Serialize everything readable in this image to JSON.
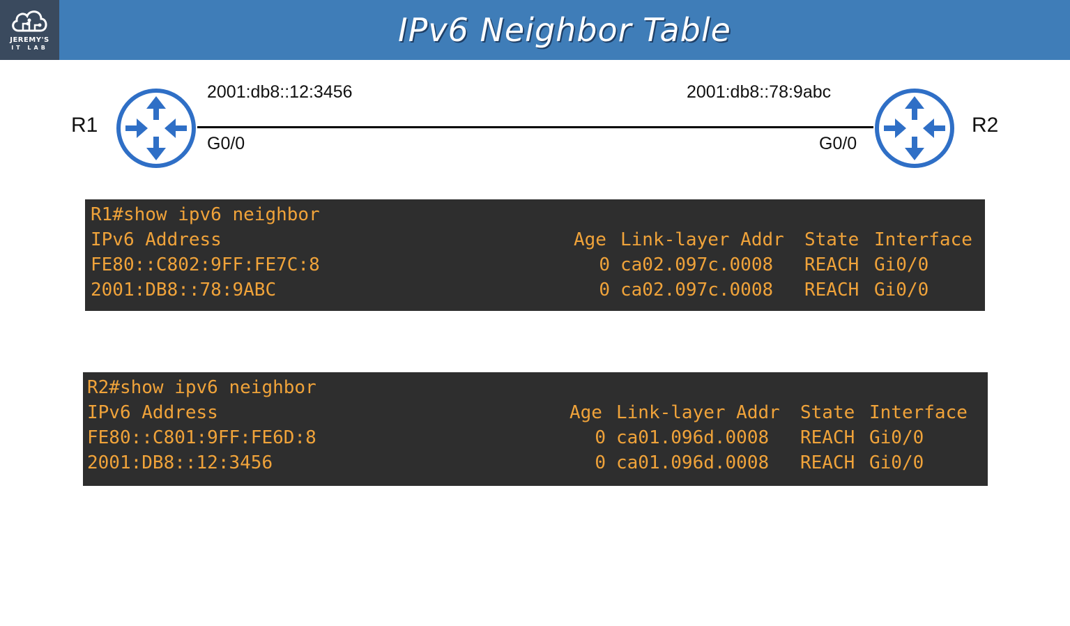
{
  "logo": {
    "line1": "JEREMY'S",
    "line2": "IT LAB"
  },
  "title": "IPv6 Neighbor Table",
  "topology": {
    "r1": {
      "name": "R1",
      "address": "2001:db8::12:3456",
      "interface": "G0/0"
    },
    "r2": {
      "name": "R2",
      "address": "2001:db8::78:9abc",
      "interface": "G0/0"
    }
  },
  "cli_r1": {
    "command": "R1#show ipv6 neighbor",
    "headers": {
      "addr": "IPv6 Address",
      "age": "Age",
      "lladdr": "Link-layer Addr",
      "state": "State",
      "iface": "Interface"
    },
    "rows": [
      {
        "addr": "FE80::C802:9FF:FE7C:8",
        "age": "0",
        "lladdr": "ca02.097c.0008",
        "state": "REACH",
        "iface": "Gi0/0"
      },
      {
        "addr": "2001:DB8::78:9ABC",
        "age": "0",
        "lladdr": "ca02.097c.0008",
        "state": "REACH",
        "iface": "Gi0/0"
      }
    ]
  },
  "cli_r2": {
    "command": "R2#show ipv6 neighbor",
    "headers": {
      "addr": "IPv6 Address",
      "age": "Age",
      "lladdr": "Link-layer Addr",
      "state": "State",
      "iface": "Interface"
    },
    "rows": [
      {
        "addr": "FE80::C801:9FF:FE6D:8",
        "age": "0",
        "lladdr": "ca01.096d.0008",
        "state": "REACH",
        "iface": "Gi0/0"
      },
      {
        "addr": "2001:DB8::12:3456",
        "age": "0",
        "lladdr": "ca01.096d.0008",
        "state": "REACH",
        "iface": "Gi0/0"
      }
    ]
  },
  "colors": {
    "header_bg": "#3f7db8",
    "router": "#2f6fc6",
    "terminal_bg": "#2e2e2e",
    "terminal_text": "#f0a33a"
  }
}
